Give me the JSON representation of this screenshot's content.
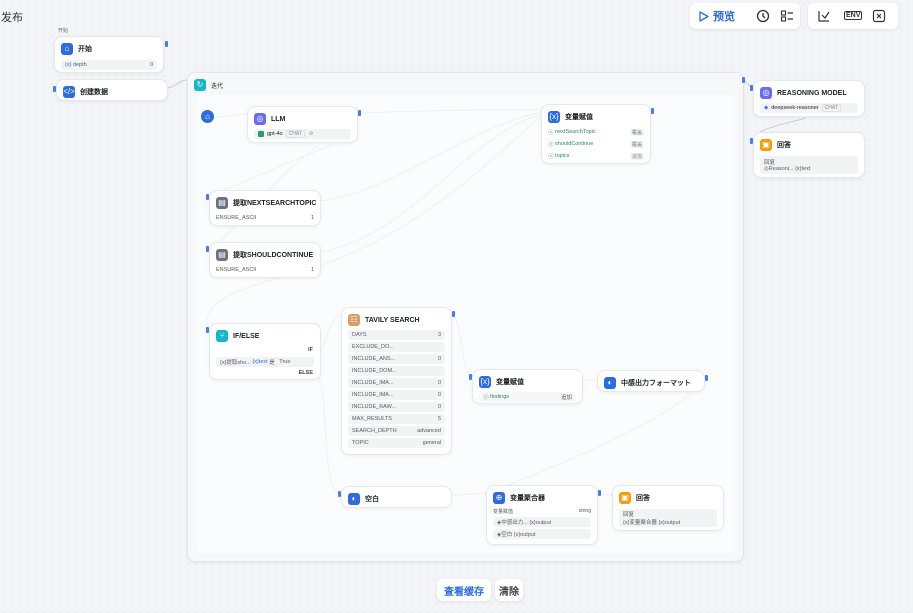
{
  "top_left_text": "发布",
  "toolbar": {
    "preview_label": "预览",
    "env_label": "ENV"
  },
  "bottom": {
    "view_cache_label": "查看缓存",
    "clear_label": "清除"
  },
  "start": {
    "caption": "开始",
    "title": "开始",
    "var_prefix": "{x}",
    "var_name": "depth",
    "var_value": "0"
  },
  "create_data": {
    "title": "创建数据"
  },
  "iteration": {
    "title": "迭代"
  },
  "llm": {
    "title": "LLM",
    "model": "gpt-4o",
    "tag": "CHAT"
  },
  "assign1": {
    "title": "变量赋值",
    "rows": [
      {
        "name": "nextSearchTopic",
        "op": "覆盖"
      },
      {
        "name": "shouldContinue",
        "op": "覆盖"
      },
      {
        "name": "topics",
        "op": "追加"
      }
    ]
  },
  "extract_next": {
    "title": "提取NEXTSEARCHTOPIC",
    "param": "ENSURE_ASCII",
    "value": "1"
  },
  "extract_should": {
    "title": "提取SHOULDCONTINUE",
    "param": "ENSURE_ASCII",
    "value": "1"
  },
  "ifelse": {
    "title": "IF/ELSE",
    "if_label": "IF",
    "cond_var": "{x}提取sho...",
    "cond_field": "{x}text",
    "cond_op": "是",
    "cond_value": "True",
    "else_label": "ELSE"
  },
  "tavily": {
    "title": "TAVILY SEARCH",
    "params": [
      {
        "name": "DAYS",
        "value": "3"
      },
      {
        "name": "EXCLUDE_DO...",
        "value": ""
      },
      {
        "name": "INCLUDE_ANS...",
        "value": "0"
      },
      {
        "name": "INCLUDE_DOM...",
        "value": ""
      },
      {
        "name": "INCLUDE_IMA...",
        "value": "0"
      },
      {
        "name": "INCLUDE_IMA...",
        "value": "0"
      },
      {
        "name": "INCLUDE_RAW...",
        "value": "0"
      },
      {
        "name": "MAX_RESULTS",
        "value": "5"
      },
      {
        "name": "SEARCH_DEPTH",
        "value": "advanced"
      },
      {
        "name": "TOPIC",
        "value": "general"
      }
    ]
  },
  "assign2": {
    "title": "变量赋值",
    "name": "findings",
    "op": "追加"
  },
  "format_out": {
    "title": "中感出力フォーマット"
  },
  "empty": {
    "title": "空白"
  },
  "aggregator": {
    "title": "变量聚合器",
    "label": "变量赋值",
    "type": "string",
    "rows": [
      "◈中感出力...  {x}output",
      "◈空白  {x}output"
    ]
  },
  "answer1": {
    "title": "回答",
    "label": "回复",
    "value": "{x}变量聚合器  {x}output"
  },
  "reasoning": {
    "title": "REASONING MODEL",
    "model": "deepseek-reasoner",
    "tag": "CHAT"
  },
  "answer2": {
    "title": "回答",
    "label": "回复",
    "value": "◎Reasoni...  {x}text"
  },
  "colors": {
    "accent": "#2d6cdf",
    "llm": "#6b6cf6",
    "answer": "#f59e0b",
    "iter": "#14b8c4"
  }
}
